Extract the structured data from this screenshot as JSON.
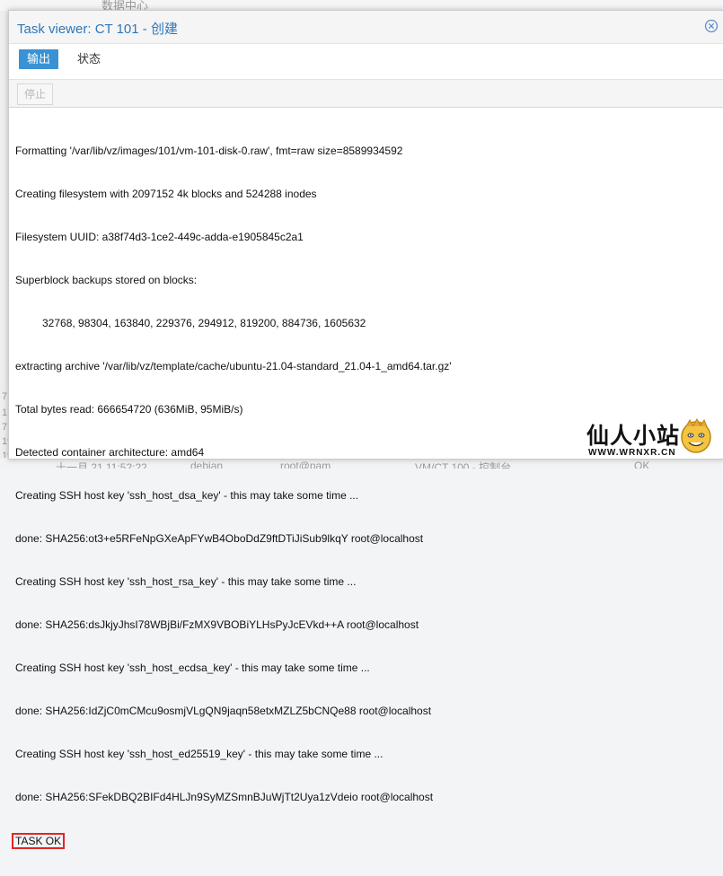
{
  "background": {
    "top_label": "数据中心",
    "left_col": [
      "7",
      "17",
      "7",
      "19",
      "19",
      "19",
      "19"
    ],
    "bottom_row": [
      "十一月 21 11:52:22",
      "debian",
      "root@pam",
      "VM/CT 100 - 控制台",
      "OK"
    ]
  },
  "window": {
    "title": "Task viewer: CT 101 - 创建",
    "close_icon": "close-icon"
  },
  "tabs": [
    {
      "label": "输出",
      "active": true
    },
    {
      "label": "状态",
      "active": false
    }
  ],
  "toolbar": {
    "stop_label": "停止"
  },
  "log": {
    "lines": [
      "Formatting '/var/lib/vz/images/101/vm-101-disk-0.raw', fmt=raw size=8589934592",
      "Creating filesystem with 2097152 4k blocks and 524288 inodes",
      "Filesystem UUID: a38f74d3-1ce2-449c-adda-e1905845c2a1",
      "Superblock backups stored on blocks:",
      "32768, 98304, 163840, 229376, 294912, 819200, 884736, 1605632",
      "extracting archive '/var/lib/vz/template/cache/ubuntu-21.04-standard_21.04-1_amd64.tar.gz'",
      "Total bytes read: 666654720 (636MiB, 95MiB/s)",
      "Detected container architecture: amd64",
      "Creating SSH host key 'ssh_host_dsa_key' - this may take some time ...",
      "done: SHA256:ot3+e5RFeNpGXeApFYwB4OboDdZ9ftDTiJiSub9lkqY root@localhost",
      "Creating SSH host key 'ssh_host_rsa_key' - this may take some time ...",
      "done: SHA256:dsJkjyJhsI78WBjBi/FzMX9VBOBiYLHsPyJcEVkd++A root@localhost",
      "Creating SSH host key 'ssh_host_ecdsa_key' - this may take some time ...",
      "done: SHA256:IdZjC0mCMcu9osmjVLgQN9jaqn58etxMZLZ5bCNQe88 root@localhost",
      "Creating SSH host key 'ssh_host_ed25519_key' - this may take some time ...",
      "done: SHA256:SFekDBQ2BIFd4HLJn9SyMZSmnBJuWjTt2Uya1zVdeio root@localhost"
    ],
    "final_status": "TASK OK"
  },
  "watermark": {
    "text": "仙人小站",
    "url": "WWW.WRNXR.CN",
    "icon": "smiley-face-icon"
  },
  "colors": {
    "accent": "#3892d4",
    "title": "#2f77b8",
    "highlight_border": "#e32424"
  }
}
